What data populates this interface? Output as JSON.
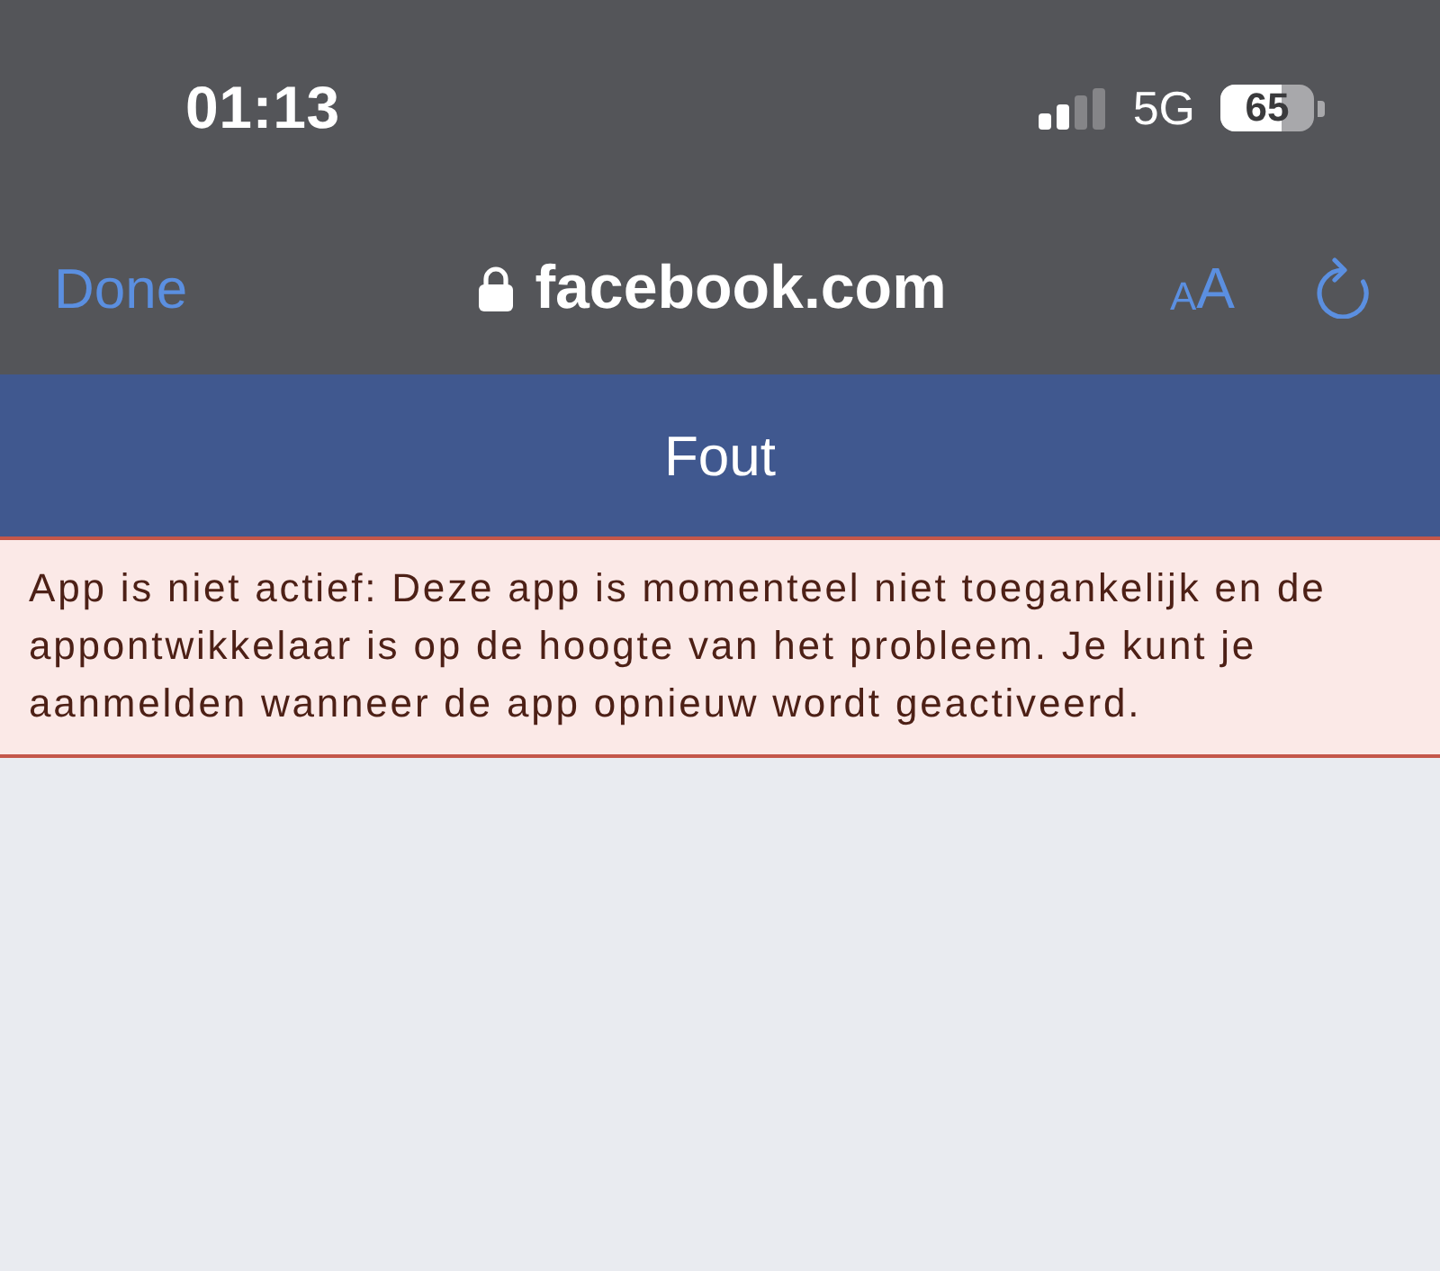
{
  "status_bar": {
    "time": "01:13",
    "network": "5G",
    "battery": "65"
  },
  "browser_bar": {
    "done": "Done",
    "url": "facebook.com",
    "text_size": "AA"
  },
  "header": {
    "title": "Fout"
  },
  "error": {
    "message": "App is niet actief: Deze app is momenteel niet toegankelijk en de appontwikkelaar is op de hoogte van het probleem. Je kunt je aanmelden wanneer de app opnieuw wordt geactiveerd."
  }
}
